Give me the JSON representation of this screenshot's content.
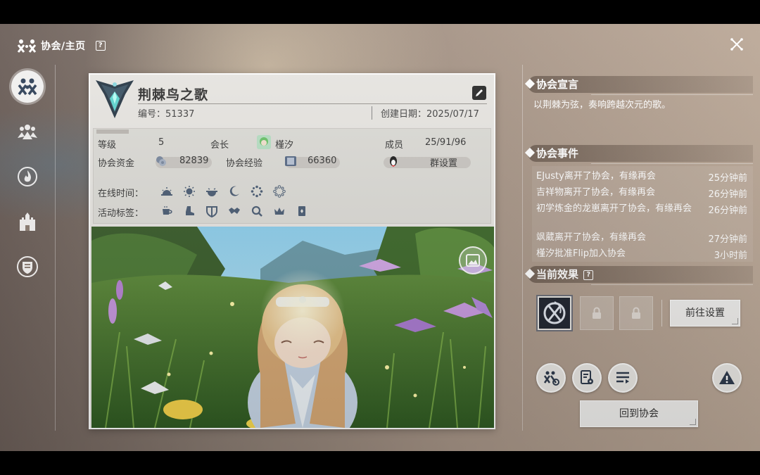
{
  "header": {
    "breadcrumb": "协会/主页",
    "help": "?"
  },
  "sidebar": {
    "items": [
      {
        "name": "guild-home",
        "icon": "guild-emblem-icon",
        "active": true
      },
      {
        "name": "members",
        "icon": "members-icon",
        "active": false
      },
      {
        "name": "activity",
        "icon": "flame-icon",
        "active": false
      },
      {
        "name": "building",
        "icon": "castle-icon",
        "active": false
      },
      {
        "name": "shop",
        "icon": "shield-icon",
        "active": false
      }
    ]
  },
  "guild": {
    "name": "荆棘鸟之歌",
    "id_label": "编号：",
    "id_value": "51337",
    "created_label": "创建日期：",
    "created_value": "2025/07/17",
    "level_label": "等级",
    "level_value": "5",
    "leader_label": "会长",
    "leader_name": "槿汐",
    "members_label": "成员",
    "members_value": "25/91/96",
    "funds_label": "协会资金",
    "funds_value": "82839",
    "exp_label": "协会经验",
    "exp_value": "66360",
    "group_label": "群设置",
    "online_label": "在线时间：",
    "tags_label": "活动标签："
  },
  "online_icons": [
    "sunrise-icon",
    "sun-icon",
    "sunset-icon",
    "moon-icon",
    "dotted-circle-icon",
    "dotted-circle-outline-icon"
  ],
  "tag_icons": [
    "cup-icon",
    "boot-icon",
    "shield-icon",
    "handshake-icon",
    "magnifier-icon",
    "crown-icon",
    "card-icon"
  ],
  "declaration": {
    "title": "协会宣言",
    "text": "以荆棘为弦，奏响跨越次元的歌。"
  },
  "events": {
    "title": "协会事件",
    "items": [
      {
        "text": "EJusty离开了协会，有缘再会",
        "time": "25分钟前"
      },
      {
        "text": "吉祥物离开了协会，有缘再会",
        "time": "26分钟前"
      },
      {
        "text": "初学炼金的龙崽离开了协会，有缘再会",
        "time": "26分钟前"
      },
      {
        "text": "飒葳离开了协会，有缘再会",
        "time": "27分钟前"
      },
      {
        "text": "槿汐批准Flip加入协会",
        "time": "3小时前"
      }
    ]
  },
  "effects": {
    "title": "当前效果",
    "help": "?",
    "goto_settings": "前往设置"
  },
  "actions": {
    "return": "回到协会"
  },
  "colors": {
    "accent": "#e9e7e3",
    "text_dark": "#333333",
    "effect_bg": "#202530"
  }
}
